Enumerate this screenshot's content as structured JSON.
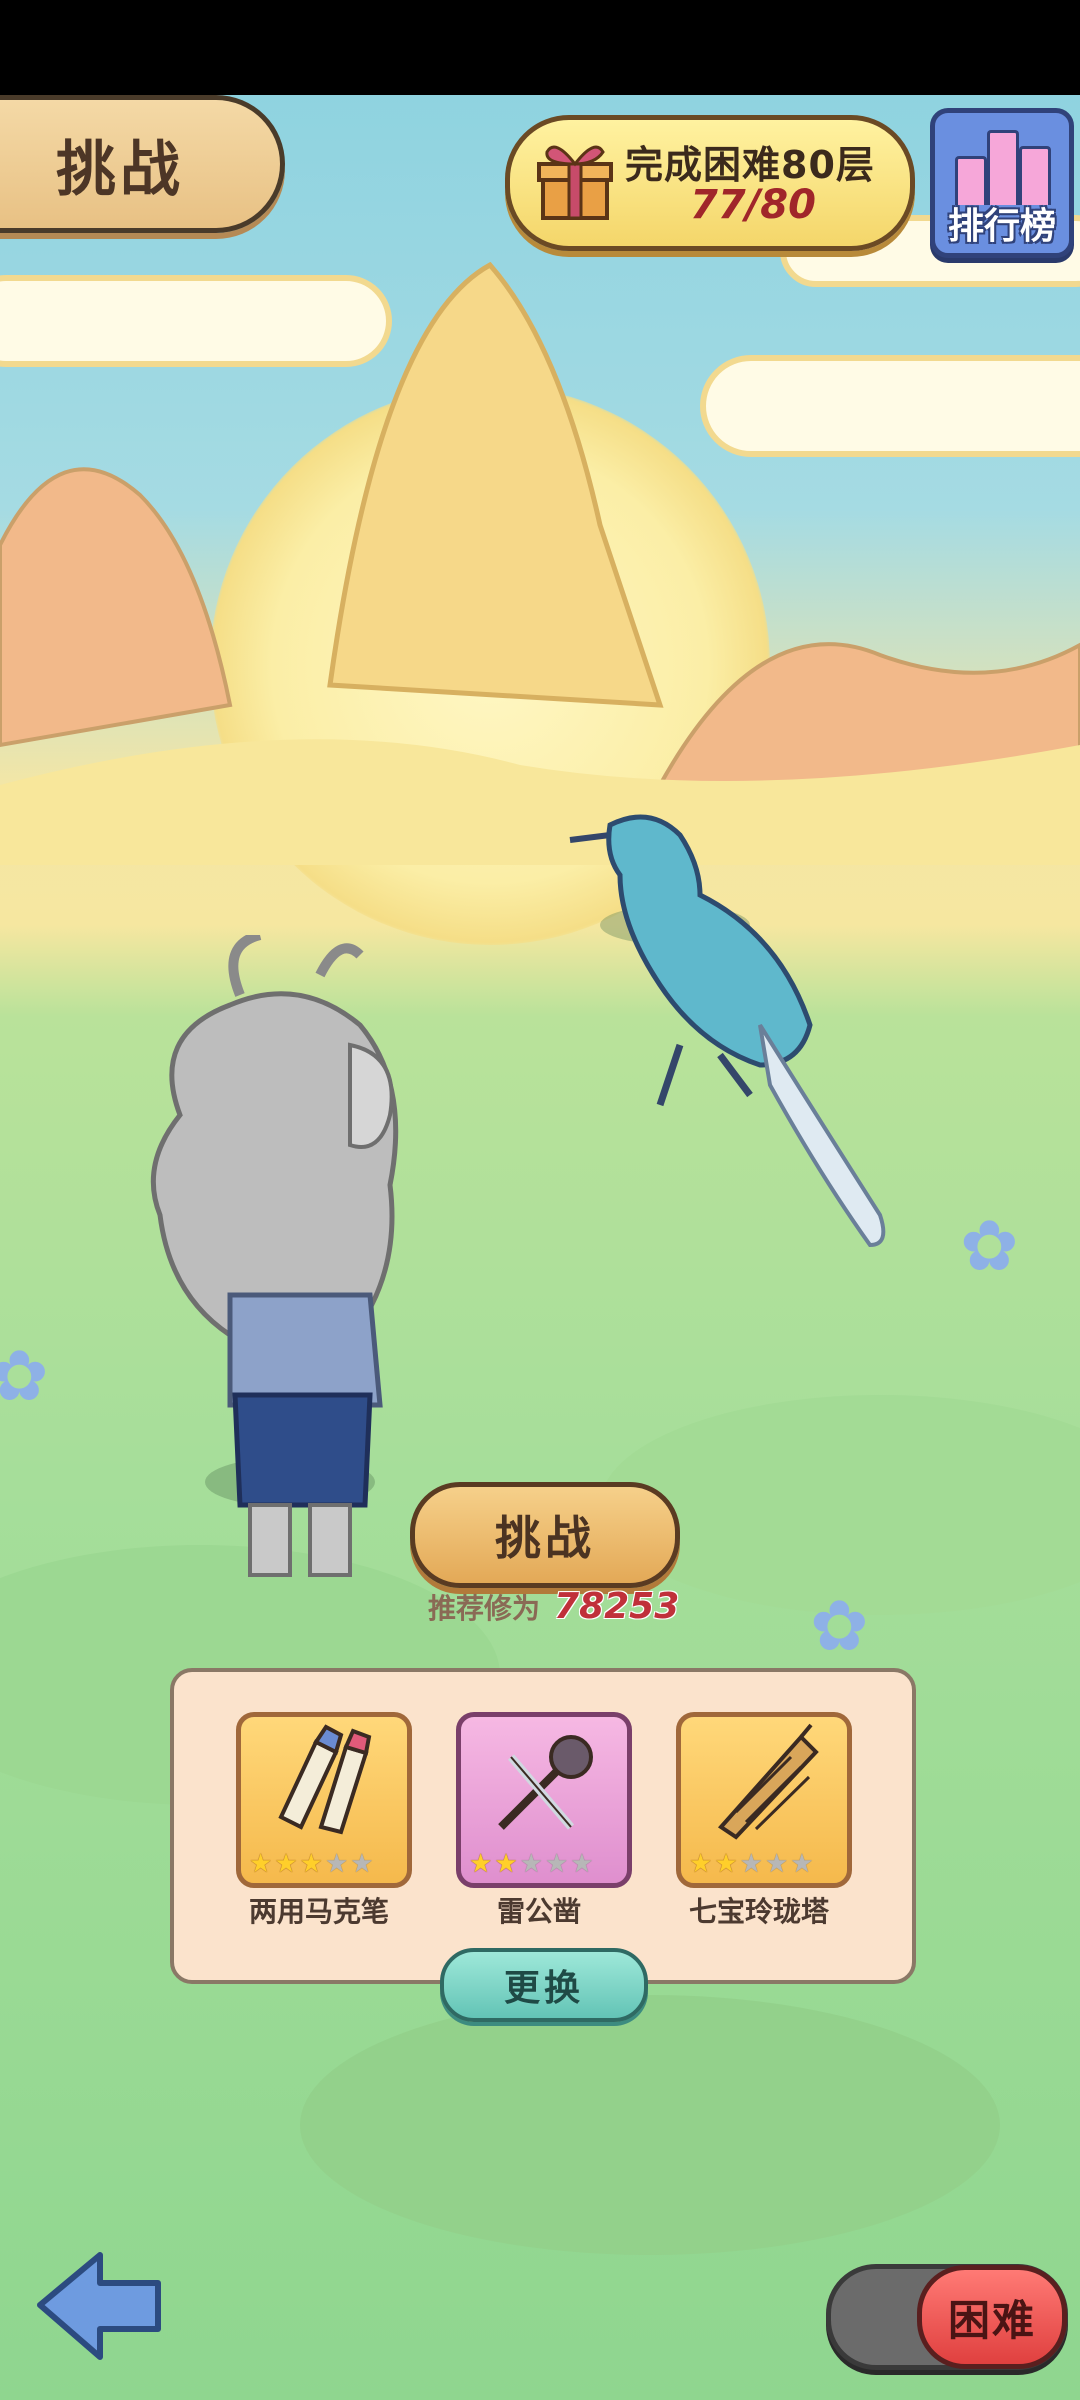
{
  "header": {
    "mode_title": "挑战",
    "task": {
      "title": "完成困难80层",
      "progress_text": "77/80",
      "current": 77,
      "target": 80
    },
    "ranking_label": "排行榜"
  },
  "battle": {
    "challenge_label": "挑战",
    "recommend_label": "推荐修为",
    "recommend_value": "78253"
  },
  "equipment": {
    "items": [
      {
        "name": "两用马克笔",
        "stars": 3,
        "max_stars": 5,
        "rarity_color": "#f5b94c",
        "icon": "marker-pens-icon"
      },
      {
        "name": "雷公凿",
        "stars": 2,
        "max_stars": 5,
        "rarity_color": "#df8fce",
        "icon": "chisel-hammer-icon"
      },
      {
        "name": "七宝玲珑塔",
        "stars": 2,
        "max_stars": 5,
        "rarity_color": "#f5b94c",
        "icon": "pagoda-icon"
      }
    ],
    "swap_label": "更换"
  },
  "footer": {
    "back_icon": "back-arrow-icon",
    "difficulty_label": "困难"
  },
  "colors": {
    "accent": "#e3a957",
    "difficulty": "#e0403f",
    "rank": "#6a8fe0"
  }
}
